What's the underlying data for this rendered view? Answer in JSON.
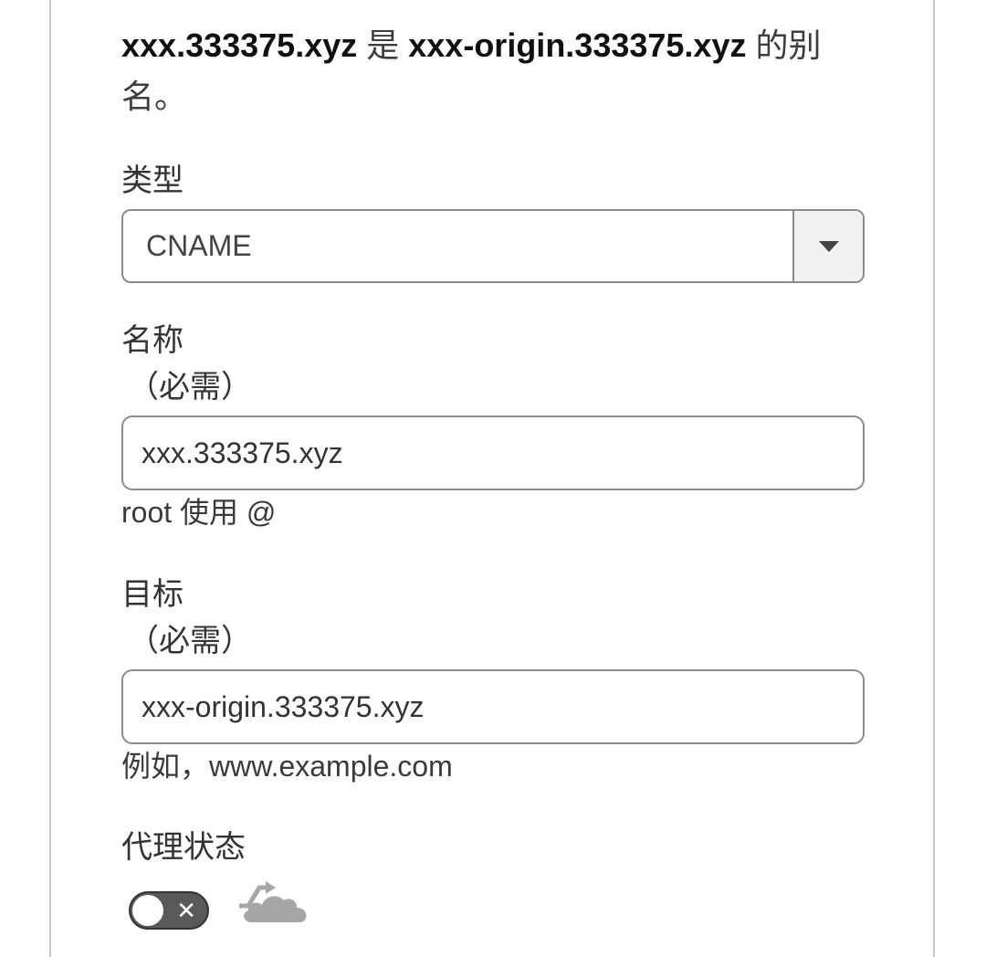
{
  "summary": {
    "source": "xxx.333375.xyz",
    "connector": " 是 ",
    "target": "xxx-origin.333375.xyz",
    "suffix": " 的别名。"
  },
  "type_field": {
    "label": "类型",
    "value": "CNAME"
  },
  "name_field": {
    "label": "名称",
    "required": "（必需）",
    "value": "xxx.333375.xyz",
    "hint": "root 使用 @"
  },
  "target_field": {
    "label": "目标",
    "required": "（必需）",
    "value": "xxx-origin.333375.xyz",
    "hint": "例如，www.example.com"
  },
  "proxy_field": {
    "label": "代理状态",
    "toggle_on": false,
    "toggle_off_glyph": "✕",
    "icon": "dns-only-cloud-icon"
  },
  "colors": {
    "border": "#8c8c8c",
    "toggle_off": "#595959",
    "cloud_gray": "#a6a6a6"
  }
}
